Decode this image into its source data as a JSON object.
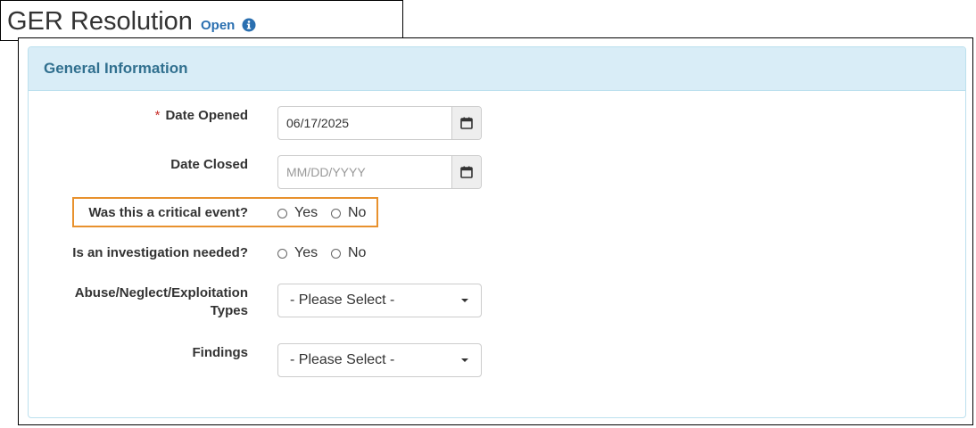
{
  "header": {
    "title": "GER Resolution",
    "status": "Open"
  },
  "panel": {
    "title": "General Information"
  },
  "form": {
    "date_opened": {
      "required_mark": "*",
      "label": "Date Opened",
      "value": "06/17/2025"
    },
    "date_closed": {
      "label": "Date Closed",
      "value": "",
      "placeholder": "MM/DD/YYYY"
    },
    "critical_event": {
      "label": "Was this a critical event?",
      "options": [
        "Yes",
        "No"
      ]
    },
    "investigation": {
      "label": "Is an investigation needed?",
      "options": [
        "Yes",
        "No"
      ]
    },
    "abuse_types": {
      "label_line1": "Abuse/Neglect/Exploitation",
      "label_line2": "Types",
      "selected": "- Please Select -"
    },
    "findings": {
      "label": "Findings",
      "selected": "- Please Select -"
    }
  },
  "colors": {
    "highlight": "#e8912d",
    "status": "#2a6fb0",
    "panel_heading_bg": "#d9edf7",
    "panel_title": "#31708f"
  }
}
